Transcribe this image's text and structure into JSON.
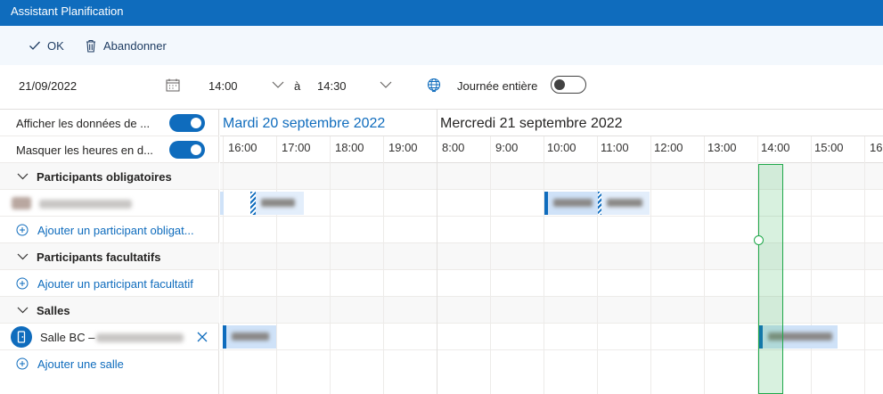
{
  "window": {
    "title": "Assistant Planification"
  },
  "commands": {
    "ok_label": "OK",
    "discard_label": "Abandonner"
  },
  "meeting": {
    "date": "21/09/2022",
    "start_time": "14:00",
    "to_label": "à",
    "end_time": "14:30",
    "all_day_label": "Journée entière"
  },
  "options": {
    "show_data_label": "Afficher les données de ...",
    "hide_hours_label": "Masquer les heures en d..."
  },
  "sections": {
    "required": {
      "title": "Participants obligatoires",
      "add_label": "Ajouter un participant obligat..."
    },
    "optional": {
      "title": "Participants facultatifs",
      "add_label": "Ajouter un participant facultatif"
    },
    "rooms": {
      "title": "Salles",
      "room_name": "Salle BC – ",
      "add_label": "Ajouter une salle"
    }
  },
  "timeline": {
    "day1": "Mardi 20 septembre 2022",
    "day2": "Mercredi 21 septembre 2022",
    "day1_hours": [
      "16:00",
      "17:00",
      "18:00",
      "19:00"
    ],
    "day2_hours": [
      "8:00",
      "9:00",
      "10:00",
      "11:00",
      "12:00",
      "13:00",
      "14:00",
      "15:00",
      "16"
    ]
  },
  "colors": {
    "accent": "#0f6cbd",
    "selection": "#1fa84a",
    "event": "#cfe2f8"
  }
}
